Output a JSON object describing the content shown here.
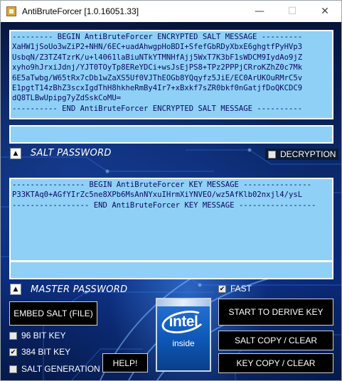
{
  "window": {
    "title": "AntiBruteForcer [1.0.16051.33]",
    "min_glyph": "—",
    "max_glyph": "☐",
    "close_glyph": "✕"
  },
  "salt_message": {
    "text": "--------- BEGIN AntiBruteForcer ENCRYPTED SALT MESSAGE ---------\nXaHW1jSoUo3wZiP2+NHN/6EC+uadAhwgpHoBDI+SfefGbRDyXbxE6ghgtfPyHVp3\nUsbqN/Z3TZ4TzrK/u+l4061laBiuNTkYTMNHfAjj5WxT7K3bF1sWDCM9IydAo9jZ\nxyho9hJrxiJdnj/YJT0TOyTp8EReYDCi+wsJsEjPS8+TPz2PPPjCRroKZhZ0c7Mk\n6E5aTwbg/W65tRx7cDb1wZaXS5Uf0VJThEOGb8YQqyfz5JiE/EC0ArUKOuRMrC5v\nE1pgtT14zBhZ3scxIgdThH8hkheRmBy4Ir7+xBxkf7sZR0bkf0nGatjfDoQKCDC9\ndQ8TLBwUpipg7yZdSskCoMU=\n---------- END AntiBruteForcer ENCRYPTED SALT MESSAGE ----------"
  },
  "salt_password": {
    "label": "SALT PASSWORD",
    "value": "",
    "spin_glyph": "▲"
  },
  "decryption": {
    "label": "DECRYPTION",
    "checked": false
  },
  "key_message": {
    "text": "---------------- BEGIN AntiBruteForcer KEY MESSAGE ---------------\nP33KTAq0+AGfYIrZc5ne8XPb6MsAnNYxuIHrmXiYNVEO/wz5AfKlb02nxjl4/ysL\n----------------- END AntiBruteForcer KEY MESSAGE -----------------"
  },
  "master_password": {
    "label": "MASTER PASSWORD",
    "value": "",
    "spin_glyph": "▲"
  },
  "options": {
    "fast": {
      "label": "FAST",
      "checked": true
    },
    "bit96": {
      "label": "96 BIT KEY",
      "checked": false
    },
    "bit384": {
      "label": "384 BIT KEY",
      "checked": true
    },
    "salt_generation": {
      "label": "SALT GENERATION",
      "checked": false
    },
    "check_glyph": "✔"
  },
  "buttons": {
    "embed_salt": "EMBED SALT (FILE)",
    "help": "HELP!",
    "derive_key": "START TO DERIVE KEY",
    "salt_copy_clear": "SALT COPY / CLEAR",
    "key_copy_clear": "KEY COPY / CLEAR"
  },
  "badge": {
    "brand": "intel",
    "sub": "inside"
  },
  "colors": {
    "textbox_bg": "#8fd0f6",
    "textbox_text": "#0a0a60",
    "button_bg": "#000000",
    "background_blue": "#0b2a6e"
  }
}
